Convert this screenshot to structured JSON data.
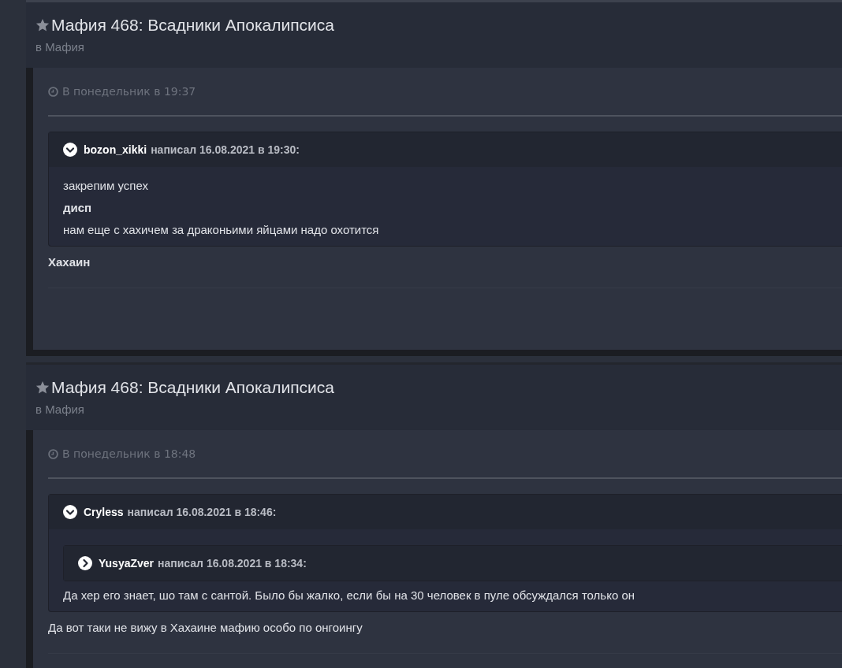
{
  "posts": [
    {
      "title": "Мафия 468: Всадники Апокалипсиса",
      "forum": "в Мафия",
      "time": "В понедельник в 19:37",
      "body": [
        {
          "kind": "quote",
          "author": "bozon_xikki",
          "meta": "написал 16.08.2021 в 19:30:",
          "expanded": true,
          "body": [
            {
              "kind": "text",
              "text": "закрепим успех",
              "bold": false
            },
            {
              "kind": "text",
              "text": "дисп",
              "bold": true
            },
            {
              "kind": "text",
              "text": "нам еще с хахичем за драконьими яйцами надо охотится",
              "bold": false
            }
          ]
        },
        {
          "kind": "text",
          "text": "Хахаин",
          "bold": true
        }
      ]
    },
    {
      "title": "Мафия 468: Всадники Апокалипсиса",
      "forum": "в Мафия",
      "time": "В понедельник в 18:48",
      "body": [
        {
          "kind": "quote",
          "author": "Cryless",
          "meta": "написал 16.08.2021 в 18:46:",
          "expanded": true,
          "body": [
            {
              "kind": "quote",
              "author": "YusyaZver",
              "meta": "написал 16.08.2021 в 18:34:",
              "expanded": false
            },
            {
              "kind": "text",
              "text": "Да хер его знает, шо там с сантой. Было бы жалко, если бы на 30 человек в пуле обсуждался только он",
              "bold": false
            }
          ]
        },
        {
          "kind": "text",
          "text": "Да вот таки не вижу в Хахаине мафию особо по онгоингу",
          "bold": false
        }
      ]
    }
  ]
}
